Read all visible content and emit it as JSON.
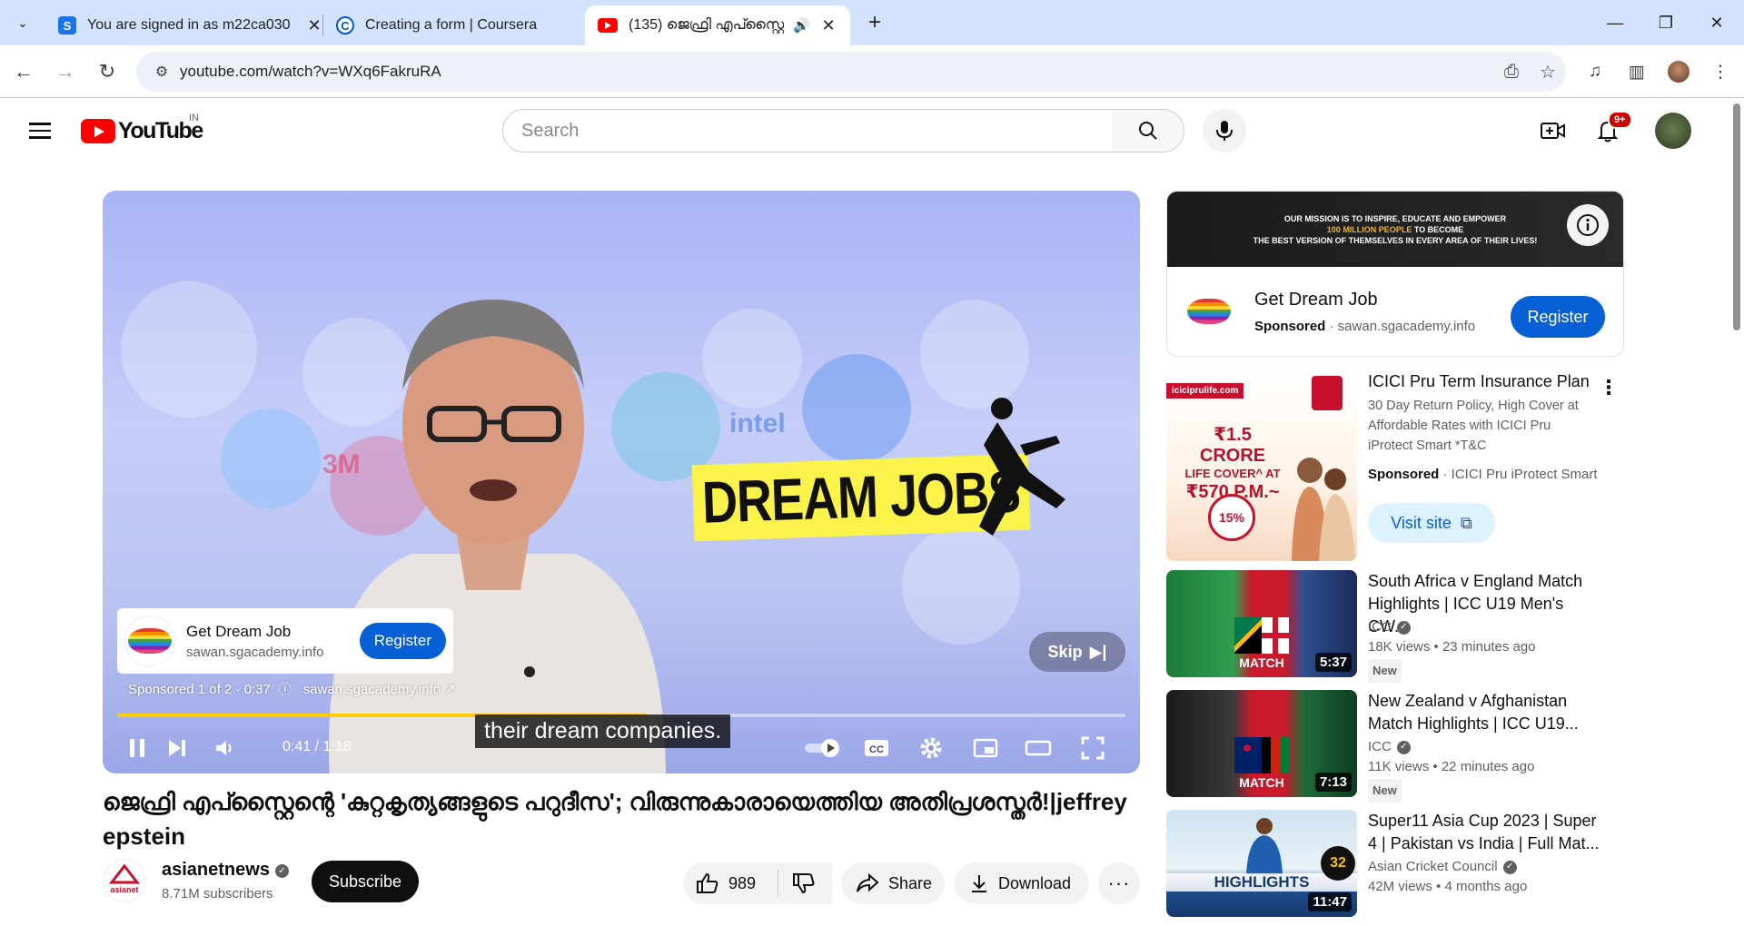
{
  "browser": {
    "tabs": [
      {
        "title": "You are signed in as m22ca030",
        "favicon": "S"
      },
      {
        "title": "Creating a form | Coursera",
        "favicon": "C"
      },
      {
        "title": "(135) ജെഫ്രി എപ്സ്റ്റൈ",
        "favicon": "youtube"
      }
    ],
    "url": "youtube.com/watch?v=WXq6FakruRA"
  },
  "youtube": {
    "country_code": "IN",
    "logo_text": "YouTube",
    "search_placeholder": "Search",
    "notification_count": "9+"
  },
  "player": {
    "banner_text": "DREAM JOBS",
    "ad_title": "Get Dream Job",
    "ad_domain": "sawan.sgacademy.info",
    "ad_button": "Register",
    "ad_meta": "Sponsored 1 of 2 · 0:37",
    "ad_meta_domain": "sawan.sgacademy.info",
    "skip_label": "Skip",
    "caption": "their dream companies.",
    "time": "0:41 / 1:18",
    "progress": 0.525
  },
  "video": {
    "title": "ജെഫ്രി എപ്സ്റ്റൈന്റെ 'കുറ്റകൃത്യങ്ങളുടെ പറുദീസ'; വിരുന്നുകാരായെത്തിയ അതിപ്രശസ്തർ!|jeffrey epstein",
    "channel": "asianetnews",
    "subscribers": "8.71M subscribers",
    "subscribe_label": "Subscribe",
    "likes": "989",
    "share_label": "Share",
    "download_label": "Download"
  },
  "sidebar_ad": {
    "banner_line1": "OUR MISSION IS TO INSPIRE, EDUCATE AND EMPOWER",
    "banner_line2": "100 MILLION PEOPLE",
    "banner_line2b": "TO BECOME",
    "banner_line3": "THE BEST VERSION OF THEMSELVES IN EVERY AREA OF THEIR LIVES!",
    "title": "Get Dream Job",
    "sponsored": "Sponsored",
    "domain": "· sawan.sgacademy.info",
    "button": "Register"
  },
  "icici_ad": {
    "title": "ICICI Pru Term Insurance Plan",
    "desc": "30 Day Return Policy, High Cover at Affordable Rates with ICICI Pru iProtect Smart *T&C",
    "sponsored": "Sponsored",
    "advertiser": "· ICICI Pru iProtect Smart",
    "button": "Visit site",
    "thumb_site": "iciciprulife.com",
    "thumb_line1": "₹1.5 CRORE",
    "thumb_line2": "LIFE COVER^ AT",
    "thumb_line3": "₹570 P.M.~",
    "thumb_badge": "15%"
  },
  "recommendations": [
    {
      "title": "South Africa v England Match Highlights | ICC U19 Men's CW...",
      "channel": "ICC",
      "meta": "18K views  • 23 minutes ago",
      "badge": "New",
      "duration": "5:37",
      "thumb_label": "MATCH"
    },
    {
      "title": "New Zealand v Afghanistan Match Highlights | ICC U19...",
      "channel": "ICC",
      "meta": "11K views  • 22 minutes ago",
      "badge": "New",
      "duration": "7:13",
      "thumb_label": "MATCH"
    },
    {
      "title": "Super11 Asia Cup 2023 | Super 4 | Pakistan vs India | Full Mat...",
      "channel": "Asian Cricket Council",
      "meta": "42M views  • 4 months ago",
      "badge": "",
      "duration": "11:47",
      "thumb_label": "HIGHLIGHTS"
    }
  ],
  "colors": {
    "yt_red": "#ff0000",
    "accent_blue": "#065fd4",
    "progress_yellow": "#ffcc00"
  }
}
